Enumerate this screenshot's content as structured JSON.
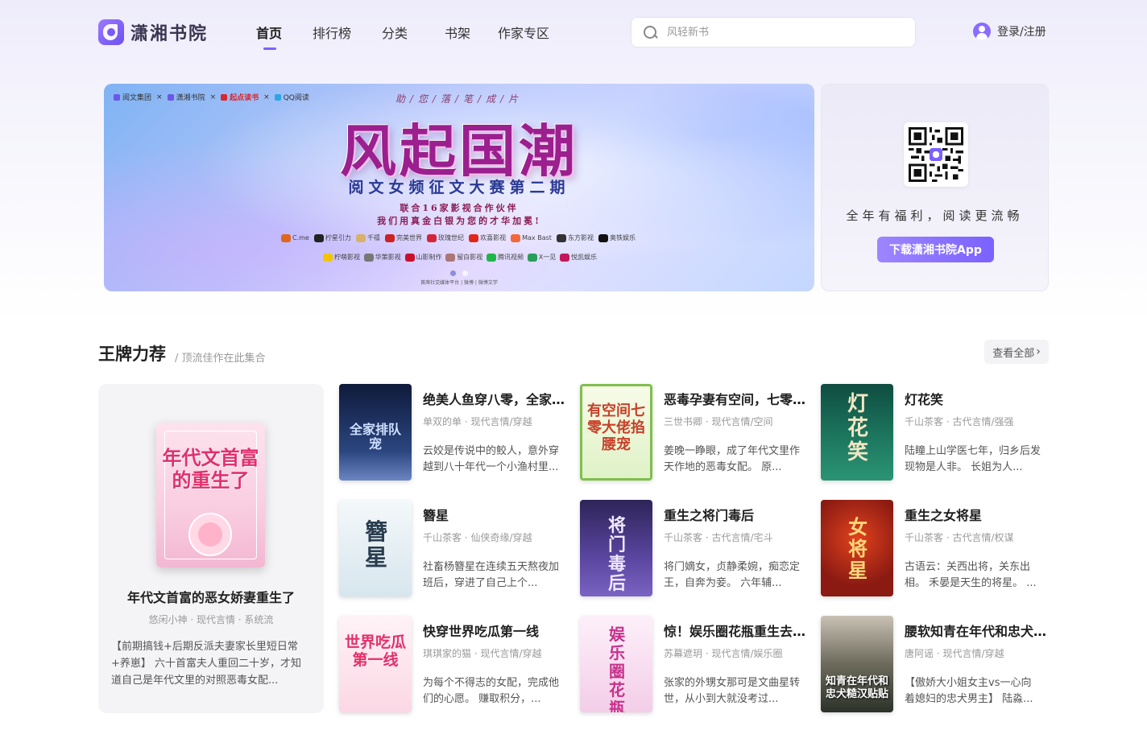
{
  "header": {
    "logo_text": "潇湘书院",
    "nav": [
      "首页",
      "排行榜",
      "分类",
      "书架",
      "作家专区"
    ],
    "search_placeholder": "风轻新书",
    "login": "登录/注册"
  },
  "banner": {
    "partners": [
      "阅文集团",
      "潇湘书院",
      "起点读书",
      "QQ阅读"
    ],
    "tagline": "助/您/落/笔/成/片",
    "title": "风起国潮",
    "subtitle": "阅文女频征文大赛第二期",
    "line1": "联合16家影视合作伙伴",
    "line2": "我们用真金白银为您的才华加冕!",
    "logos_row1": [
      "C.me",
      "柠星引力",
      "千禧",
      "完美世界",
      "玫瑰世纪",
      "欢喜影视",
      "Max Bast",
      "东方影视",
      "奥铁娱乐"
    ],
    "logos_row2": [
      "柠萌影视",
      "华策影视",
      "山影制作",
      "留白影视",
      "腾讯视频",
      "X一见",
      "悦凯娱乐"
    ],
    "footer": "首席社交媒体平台 | 微博 | 微博文学"
  },
  "app_card": {
    "slogan": "全年有福利，阅读更流畅",
    "button": "下载潇湘书院App"
  },
  "section": {
    "title": "王牌力荐",
    "subtitle": "/ 顶流佳作在此集合",
    "view_all": "查看全部"
  },
  "featured": {
    "cover_text": "年代文首富的重生了",
    "title": "年代文首富的恶女娇妻重生了",
    "meta": "悠闲小神 · 现代言情 · 系统流",
    "desc": "【前期搞钱+后期反派夫妻家长里短日常+养崽】 六十首富夫人重回二十岁，才知道自己是年代文里的对照恶毒女配..."
  },
  "books": [
    {
      "title": "绝美人鱼穿八零，全家排队宠我",
      "meta": "单双的单 · 现代言情/穿越",
      "desc": "云姣是传说中的鲛人，意外穿越到八十年代一个小渔村里...",
      "cover_text": "全家排队宠",
      "cover_bg": "#1c2a55",
      "cover_fg": "#cfe0ff"
    },
    {
      "title": "恶毒孕妻有空间，七零大佬掐腰宠",
      "meta": "三世书卿 · 现代言情/空间",
      "desc": "姜晚一睁眼，成了年代文里作天作地的恶毒女配。 原...",
      "cover_text": "有空间七零大佬掐腰宠",
      "cover_bg": "#e8f6d8",
      "cover_fg": "#c8402a"
    },
    {
      "title": "灯花笑",
      "meta": "千山茶客 · 古代言情/强强",
      "desc": "陆瞳上山学医七年，归乡后发现物是人非。 长姐为人...",
      "cover_text": "灯花笑",
      "cover_bg": "#145c4a",
      "cover_fg": "#f2e6c4"
    },
    {
      "title": "簪星",
      "meta": "千山茶客 · 仙侠奇缘/穿越",
      "desc": "社畜杨簪星在连续五天熬夜加班后，穿进了自己上个...",
      "cover_text": "簪星",
      "cover_bg": "#e4eef2",
      "cover_fg": "#2a3d4f"
    },
    {
      "title": "重生之将门毒后",
      "meta": "千山茶客 · 古代言情/宅斗",
      "desc": "将门嫡女，贞静柔婉，痴恋定王，自奔为妾。 六年辅...",
      "cover_text": "将门毒后",
      "cover_bg": "#4a3a7a",
      "cover_fg": "#efe8ff"
    },
    {
      "title": "重生之女将星",
      "meta": "千山茶客 · 古代言情/权谋",
      "desc": "古语云：关西出将，关东出相。 禾晏是天生的将星。 ...",
      "cover_text": "女将星",
      "cover_bg": "#8a1a12",
      "cover_fg": "#ffd87a"
    },
    {
      "title": "快穿世界吃瓜第一线",
      "meta": "琪琪家的猫 · 现代言情/穿越",
      "desc": "为每个不得志的女配，完成他们的心愿。 赚取积分，...",
      "cover_text": "世界吃瓜第一线",
      "cover_bg": "#fde6ee",
      "cover_fg": "#e2306b"
    },
    {
      "title": "惊！娱乐圈花瓶重生去做科学家了",
      "meta": "苏幕遮玥 · 现代言情/娱乐圈",
      "desc": "张家的外甥女那可是文曲星转世，从小到大就没考过...",
      "cover_text": "娱乐圈花瓶",
      "cover_bg": "#f7dff2",
      "cover_fg": "#c7318b"
    },
    {
      "title": "腰软知青在年代和忠犬糙汉贴贴",
      "meta": "唐阿谣 · 现代言情/穿越",
      "desc": "【傲娇大小姐女主vs一心向着媳妇的忠犬男主】 陆淼...",
      "cover_text": "知青在年代和忠犬糙汉贴贴",
      "cover_bg": "#3b4a3f",
      "cover_fg": "#ffffff"
    }
  ]
}
